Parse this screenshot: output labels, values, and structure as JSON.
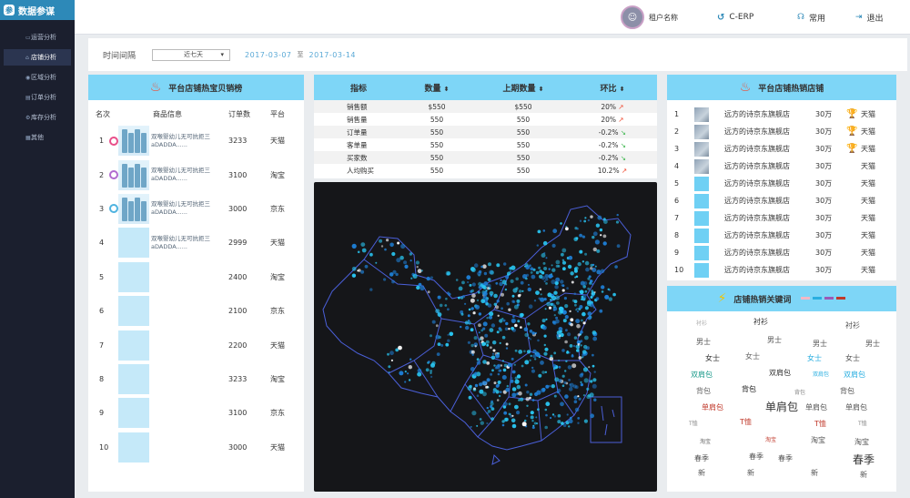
{
  "app": {
    "logo_glyph": "参",
    "title": "数据参谋"
  },
  "sidebar": {
    "items": [
      {
        "label": "运营分析",
        "icon": "bar-chart-icon",
        "active": false
      },
      {
        "label": "店铺分析",
        "icon": "store-icon",
        "active": true
      },
      {
        "label": "区域分析",
        "icon": "location-pin-icon",
        "active": false
      },
      {
        "label": "订单分析",
        "icon": "order-icon",
        "active": false
      },
      {
        "label": "库存分析",
        "icon": "gear-icon",
        "active": false
      },
      {
        "label": "其他",
        "icon": "grid-icon",
        "active": false
      }
    ]
  },
  "header": {
    "tenant_name": "租户名称",
    "erp_label": "C-ERP",
    "frequent_label": "常用",
    "logout_label": "退出"
  },
  "filter": {
    "label": "时间间隔",
    "select_value": "近七天",
    "date_from": "2017-03-07",
    "date_sep": "至",
    "date_to": "2017-03-14"
  },
  "top_products": {
    "title": "平台店铺热宝贝销榜",
    "columns": [
      "名次",
      "商品信息",
      "订单数",
      "平台"
    ],
    "rows": [
      {
        "rank": "1",
        "desc": "双喉婴幼儿无可抗拒三aDADDA......",
        "orders": "3233",
        "platform": "天猫",
        "medal": "gold",
        "has_image": true
      },
      {
        "rank": "2",
        "desc": "双喉婴幼儿无可抗拒三aDADDA......",
        "orders": "3100",
        "platform": "淘宝",
        "medal": "silver",
        "has_image": true
      },
      {
        "rank": "3",
        "desc": "双喉婴幼儿无可抗拒三aDADDA......",
        "orders": "3000",
        "platform": "京东",
        "medal": "bronze",
        "has_image": true
      },
      {
        "rank": "4",
        "desc": "双喉婴幼儿无可抗拒三aDADDA......",
        "orders": "2999",
        "platform": "天猫",
        "medal": "",
        "has_image": false
      },
      {
        "rank": "5",
        "desc": "",
        "orders": "2400",
        "platform": "淘宝",
        "medal": "",
        "has_image": false
      },
      {
        "rank": "6",
        "desc": "",
        "orders": "2100",
        "platform": "京东",
        "medal": "",
        "has_image": false
      },
      {
        "rank": "7",
        "desc": "",
        "orders": "2200",
        "platform": "天猫",
        "medal": "",
        "has_image": false
      },
      {
        "rank": "8",
        "desc": "",
        "orders": "3233",
        "platform": "淘宝",
        "medal": "",
        "has_image": false
      },
      {
        "rank": "9",
        "desc": "",
        "orders": "3100",
        "platform": "京东",
        "medal": "",
        "has_image": false
      },
      {
        "rank": "10",
        "desc": "",
        "orders": "3000",
        "platform": "天猫",
        "medal": "",
        "has_image": false
      }
    ]
  },
  "stats": {
    "columns": [
      "指标",
      "数量",
      "上期数量",
      "环比"
    ],
    "rows": [
      {
        "metric": "销售额",
        "value": "$550",
        "prev": "$550",
        "ratio": "20%",
        "trend": "up"
      },
      {
        "metric": "销售量",
        "value": "550",
        "prev": "550",
        "ratio": "20%",
        "trend": "up"
      },
      {
        "metric": "订单量",
        "value": "550",
        "prev": "550",
        "ratio": "-0.2%",
        "trend": "down"
      },
      {
        "metric": "客单量",
        "value": "550",
        "prev": "550",
        "ratio": "-0.2%",
        "trend": "down"
      },
      {
        "metric": "买家数",
        "value": "550",
        "prev": "550",
        "ratio": "-0.2%",
        "trend": "down"
      },
      {
        "metric": "人均购买",
        "value": "550",
        "prev": "550",
        "ratio": "10.2%",
        "trend": "up"
      }
    ]
  },
  "top_shops": {
    "title": "平台店铺热销店铺",
    "rows": [
      {
        "rank": "1",
        "name": "远方的诗京东旗舰店",
        "sales": "30万",
        "platform": "天猫",
        "trophy": "gold",
        "has_image": true
      },
      {
        "rank": "2",
        "name": "远方的诗京东旗舰店",
        "sales": "30万",
        "platform": "天猫",
        "trophy": "silver",
        "has_image": true
      },
      {
        "rank": "3",
        "name": "远方的诗京东旗舰店",
        "sales": "30万",
        "platform": "天猫",
        "trophy": "bronze",
        "has_image": true
      },
      {
        "rank": "4",
        "name": "远方的诗京东旗舰店",
        "sales": "30万",
        "platform": "天猫",
        "trophy": "",
        "has_image": true
      },
      {
        "rank": "5",
        "name": "远方的诗京东旗舰店",
        "sales": "30万",
        "platform": "天猫",
        "trophy": "",
        "has_image": false
      },
      {
        "rank": "6",
        "name": "远方的诗京东旗舰店",
        "sales": "30万",
        "platform": "天猫",
        "trophy": "",
        "has_image": false
      },
      {
        "rank": "7",
        "name": "远方的诗京东旗舰店",
        "sales": "30万",
        "platform": "天猫",
        "trophy": "",
        "has_image": false
      },
      {
        "rank": "8",
        "name": "远方的诗京东旗舰店",
        "sales": "30万",
        "platform": "天猫",
        "trophy": "",
        "has_image": false
      },
      {
        "rank": "9",
        "name": "远方的诗京东旗舰店",
        "sales": "30万",
        "platform": "天猫",
        "trophy": "",
        "has_image": false
      },
      {
        "rank": "10",
        "name": "远方的诗京东旗舰店",
        "sales": "30万",
        "platform": "天猫",
        "trophy": "",
        "has_image": false
      }
    ]
  },
  "keywords": {
    "title": "店铺热销关键词",
    "legend_colors": [
      "#f2b8c6",
      "#29aee0",
      "#9b59b6",
      "#c0392b"
    ],
    "words": [
      {
        "text": "衬衫",
        "color": "#aaaaaa",
        "weight": "light"
      },
      {
        "text": "衬衫",
        "color": "#333333",
        "weight": "normal"
      },
      {
        "text": "衬衫",
        "color": "#555555",
        "weight": "normal"
      },
      {
        "text": "男士",
        "color": "#555555",
        "weight": "normal"
      },
      {
        "text": "男士",
        "color": "#555555",
        "weight": "normal"
      },
      {
        "text": "男士",
        "color": "#555555",
        "weight": "normal"
      },
      {
        "text": "男士",
        "color": "#555555",
        "weight": "normal"
      },
      {
        "text": "女士",
        "color": "#333333",
        "weight": "normal"
      },
      {
        "text": "女士",
        "color": "#666666",
        "weight": "normal"
      },
      {
        "text": "女士",
        "color": "#29aee0",
        "weight": "normal"
      },
      {
        "text": "女士",
        "color": "#555555",
        "weight": "normal"
      },
      {
        "text": "双肩包",
        "color": "#1a9a8a",
        "weight": "normal"
      },
      {
        "text": "双肩包",
        "color": "#333333",
        "weight": "normal"
      },
      {
        "text": "双肩包",
        "color": "#29aee0",
        "weight": "light"
      },
      {
        "text": "双肩包",
        "color": "#29aee0",
        "weight": "normal"
      },
      {
        "text": "背包",
        "color": "#666666",
        "weight": "normal"
      },
      {
        "text": "背包",
        "color": "#222222",
        "weight": "normal"
      },
      {
        "text": "背包",
        "color": "#888888",
        "weight": "light"
      },
      {
        "text": "背包",
        "color": "#555555",
        "weight": "normal"
      },
      {
        "text": "单肩包",
        "color": "#c0392b",
        "weight": "normal"
      },
      {
        "text": "单肩包",
        "color": "#333333",
        "weight": "big"
      },
      {
        "text": "单肩包",
        "color": "#555555",
        "weight": "normal"
      },
      {
        "text": "单肩包",
        "color": "#555555",
        "weight": "normal"
      },
      {
        "text": "T恤",
        "color": "#888888",
        "weight": "light"
      },
      {
        "text": "T恤",
        "color": "#c0392b",
        "weight": "normal"
      },
      {
        "text": "T恤",
        "color": "#c0392b",
        "weight": "normal"
      },
      {
        "text": "T恤",
        "color": "#888888",
        "weight": "light"
      },
      {
        "text": "淘宝",
        "color": "#666666",
        "weight": "light"
      },
      {
        "text": "淘宝",
        "color": "#c0392b",
        "weight": "light"
      },
      {
        "text": "淘宝",
        "color": "#555555",
        "weight": "normal"
      },
      {
        "text": "淘宝",
        "color": "#555555",
        "weight": "normal"
      },
      {
        "text": "春季",
        "color": "#555555",
        "weight": "normal"
      },
      {
        "text": "春季",
        "color": "#555555",
        "weight": "normal"
      },
      {
        "text": "春季",
        "color": "#555555",
        "weight": "normal"
      },
      {
        "text": "春季",
        "color": "#333333",
        "weight": "big"
      },
      {
        "text": "新",
        "color": "#555555",
        "weight": "normal"
      },
      {
        "text": "新",
        "color": "#555555",
        "weight": "normal"
      },
      {
        "text": "新",
        "color": "#555555",
        "weight": "normal"
      },
      {
        "text": "新",
        "color": "#555555",
        "weight": "normal"
      }
    ]
  },
  "colors": {
    "accent": "#7ed6f7",
    "sidebar_bg": "#1b1f2e",
    "logo_bg": "#2d89b8",
    "up": "#f04e36",
    "down": "#39b54a"
  }
}
